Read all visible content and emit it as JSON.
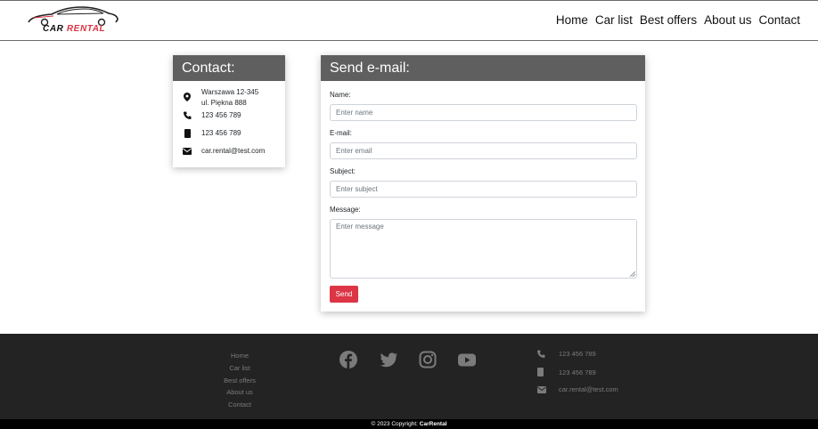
{
  "brand": {
    "word1": "CAR",
    "word2": "RENTAL"
  },
  "nav": [
    {
      "label": "Home"
    },
    {
      "label": "Car list"
    },
    {
      "label": "Best offers"
    },
    {
      "label": "About us"
    },
    {
      "label": "Contact"
    }
  ],
  "contact": {
    "title": "Contact:",
    "address_line1": "Warszawa 12-345",
    "address_line2": "ul. Piękna 888",
    "phone": "123 456 789",
    "mobile": "123 456 789",
    "email": "car.rental@test.com"
  },
  "form": {
    "title": "Send e-mail:",
    "name_label": "Name:",
    "name_placeholder": "Enter name",
    "email_label": "E-mail:",
    "email_placeholder": "Enter email",
    "subject_label": "Subject:",
    "subject_placeholder": "Enter subject",
    "message_label": "Message:",
    "message_placeholder": "Enter message",
    "send_label": "Send"
  },
  "footer": {
    "links": [
      {
        "label": "Home"
      },
      {
        "label": "Car list"
      },
      {
        "label": "Best offers"
      },
      {
        "label": "About us"
      },
      {
        "label": "Contact"
      }
    ],
    "social_icons": [
      "facebook-icon",
      "twitter-icon",
      "instagram-icon",
      "youtube-icon"
    ],
    "phone": "123 456 789",
    "mobile": "123 456 789",
    "email": "car.rental@test.com"
  },
  "copyright": {
    "prefix": "© 2023 Copyright:",
    "brand": "CarRental"
  },
  "colors": {
    "accent": "#dc3545",
    "header_bg": "#5f5f5f",
    "footer_bg": "#232323",
    "footer_text": "#7b7b7b"
  }
}
